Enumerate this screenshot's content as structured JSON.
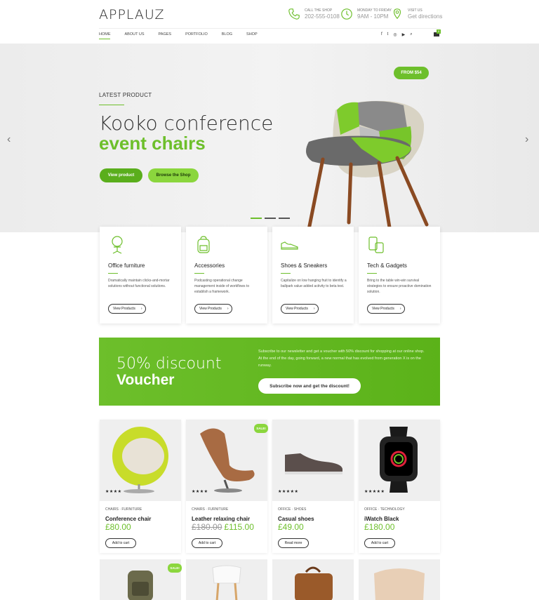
{
  "header": {
    "logo": "APPLAUZ",
    "call_label": "CALL THE SHOP",
    "call_value": "202-555-0108",
    "hours_label": "MONDAY TO FRIDAY",
    "hours_value": "9AM - 10PM",
    "visit_label": "VISIT US",
    "visit_value": "Get directions",
    "nav": [
      "HOME",
      "ABOUT US",
      "PAGES",
      "PORTFOLIO",
      "BLOG",
      "SHOP"
    ],
    "cart_count": "0"
  },
  "hero": {
    "kicker": "LATEST PRODUCT",
    "title_line1": "Kooko conference",
    "title_line2": "event chairs",
    "btn_view": "View product",
    "btn_shop": "Browse the Shop",
    "price_tag": "FROM $54"
  },
  "categories": [
    {
      "title": "Office furniture",
      "desc": "Dramatically maintain clicks-and-mortar solutions without functional solutions.",
      "btn": "View Products"
    },
    {
      "title": "Accessories",
      "desc": "Podcasting operational change management inside of workflows to establish a framework.",
      "btn": "View Products"
    },
    {
      "title": "Shoes & Sneakers",
      "desc": "Capitalize on low hanging fruit to identify a ballpark value added activity to beta test.",
      "btn": "View Products"
    },
    {
      "title": "Tech & Gadgets",
      "desc": "Bring to the table win-win survival strategies to ensure proactive domination solution.",
      "btn": "View Products"
    }
  ],
  "voucher": {
    "line1": "50% discount",
    "line2": "Voucher",
    "text": "Subscribe to our newsletter and get a voucher with 50% discount for shopping at our online shop. At the end of the day, going forward, a new normal that has evolved from generation X is on the runway.",
    "btn": "Subscribe now and get the discount!"
  },
  "products": [
    {
      "cat1": "CHAIRS",
      "cat2": "FURNITURE",
      "name": "Conference chair",
      "old_price": "",
      "price": "£80.00",
      "btn": "Add to cart",
      "stars": "★★★★",
      "sale": ""
    },
    {
      "cat1": "CHAIRS",
      "cat2": "FURNITURE",
      "name": "Leather relaxing chair",
      "old_price": "£180.00",
      "price": "£115.00",
      "btn": "Add to cart",
      "stars": "★★★★",
      "sale": "SALE!"
    },
    {
      "cat1": "OFFICE",
      "cat2": "SHOES",
      "name": "Casual shoes",
      "old_price": "",
      "price": "£49.00",
      "btn": "Read more",
      "stars": "★★★★★",
      "sale": ""
    },
    {
      "cat1": "OFFICE",
      "cat2": "TECHNOLOGY",
      "name": "iWatch Black",
      "old_price": "",
      "price": "£180.00",
      "btn": "Add to cart",
      "stars": "★★★★★",
      "sale": ""
    }
  ],
  "row2_sale": "SALE!",
  "colors": {
    "accent": "#6dbf2b"
  }
}
